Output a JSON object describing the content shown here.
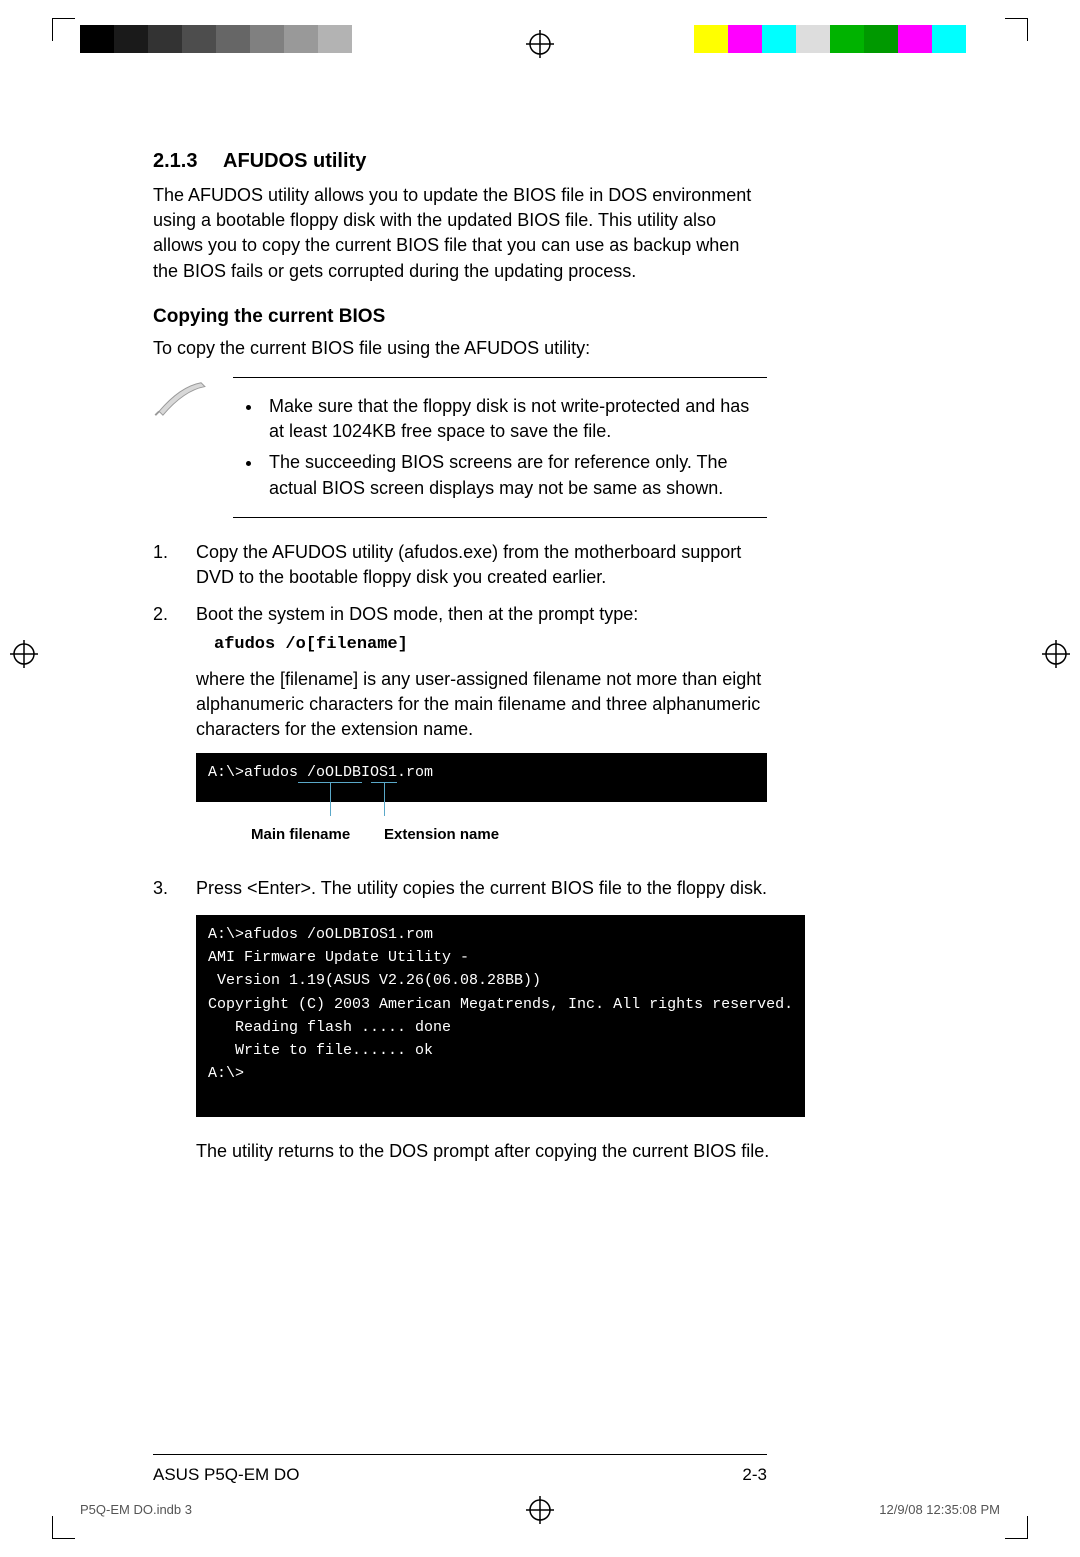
{
  "section": {
    "number": "2.1.3",
    "title": "AFUDOS utility"
  },
  "intro": "The AFUDOS utility allows you to update the BIOS file in DOS environment using a bootable floppy disk with the updated BIOS file. This utility also allows you to copy the current BIOS file that you can use as backup when the BIOS fails or gets corrupted during the updating process.",
  "subhead": "Copying the current BIOS",
  "subintro": "To copy the current BIOS file using the AFUDOS utility:",
  "notes": [
    "Make sure that the floppy disk is not write-protected and has at least 1024KB free space to save the file.",
    "The succeeding BIOS screens are for reference only. The actual BIOS screen displays may not be same as shown."
  ],
  "steps": [
    {
      "n": "1.",
      "t": "Copy the AFUDOS utility (afudos.exe) from the motherboard support DVD to the bootable floppy disk you created earlier."
    },
    {
      "n": "2.",
      "t": "Boot the system in DOS mode, then at the prompt type:"
    },
    {
      "n": "3.",
      "t": "Press <Enter>. The utility copies the current BIOS file to the floppy disk."
    }
  ],
  "command": "afudos /o[filename]",
  "cmdnote": "where the [filename] is any user-assigned filename not more than eight alphanumeric characters for the main filename and three alphanumeric characters for the extension name.",
  "term1": "A:\\>afudos /oOLDBIOS1.rom",
  "annot": {
    "main": "Main filename",
    "ext": "Extension name"
  },
  "term2": [
    "A:\\>afudos /oOLDBIOS1.rom",
    "AMI Firmware Update Utility - Version 1.19(ASUS V2.26(06.08.28BB))",
    "Copyright (C) 2003 American Megatrends, Inc. All rights reserved.",
    "   Reading flash ..... done",
    "   Write to file...... ok",
    "A:\\>",
    " "
  ],
  "closing": "The utility returns to the DOS prompt after copying the current BIOS file.",
  "footer": {
    "left": "ASUS P5Q-EM DO",
    "right": "2-3"
  },
  "print": {
    "left": "P5Q-EM DO.indb   3",
    "right": "12/9/08   12:35:08 PM"
  },
  "colors": {
    "gray": [
      "#000000",
      "#1a1a1a",
      "#333333",
      "#4d4d4d",
      "#666666",
      "#808080",
      "#999999",
      "#b3b3b3",
      "#ffffff"
    ],
    "color": [
      "#ffff00",
      "#ff00ff",
      "#00ffff",
      "#dddddd",
      "#00b300",
      "#009900",
      "#ff00ff",
      "#00ffff",
      "#ffffff"
    ]
  }
}
